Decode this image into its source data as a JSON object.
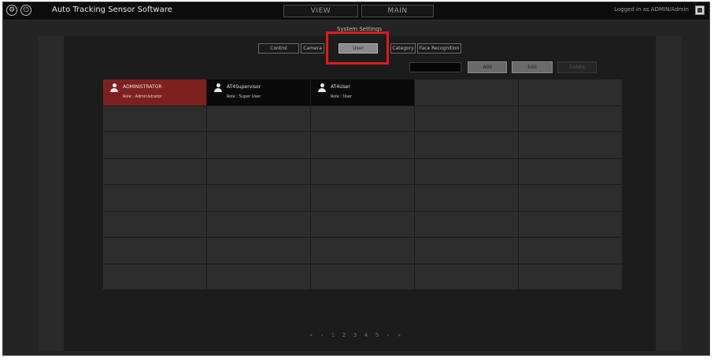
{
  "app": {
    "title": "Auto Tracking Sensor Software",
    "login_info": "Logged in as ADMIN/Admin",
    "sub_title": "System Settings"
  },
  "top_tabs": [
    {
      "label": "VIEW"
    },
    {
      "label": "MAIN"
    }
  ],
  "settings_tabs": [
    {
      "label": "Control"
    },
    {
      "label": "Camera"
    },
    {
      "label": "User",
      "active": true
    },
    {
      "label": "Category"
    },
    {
      "label": "Face Recognition"
    }
  ],
  "actions": {
    "search_placeholder": "",
    "add_label": "Add",
    "edit_label": "Edit",
    "delete_label": "Delete"
  },
  "users": [
    {
      "name": "ADMINISTRATOR",
      "role": "Role : Administrator",
      "selected": true
    },
    {
      "name": "AT4Supervisor",
      "role": "Role : Super User",
      "selected": false
    },
    {
      "name": "AT4User",
      "role": "Role : User",
      "selected": false
    }
  ],
  "grid": {
    "columns": 5,
    "rows": 8
  },
  "pagination": {
    "items": [
      "«",
      "‹",
      "1",
      "2",
      "3",
      "4",
      "5",
      "›",
      "»"
    ],
    "current": "1"
  },
  "colors": {
    "selected_user": "#7e2020",
    "highlight_box": "#e11a1a",
    "current_page": "#c62a2a"
  }
}
